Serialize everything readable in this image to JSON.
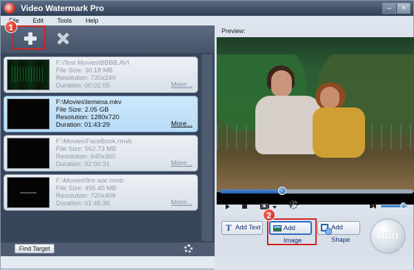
{
  "window": {
    "title": "Video Watermark Pro",
    "controls": {
      "minimize": "–",
      "close": "×"
    }
  },
  "menu": [
    "File",
    "Edit",
    "Tools",
    "Help"
  ],
  "left_panel": {
    "markers": {
      "first": "1"
    },
    "files": [
      {
        "path": "F:\\Test Movies\\BBBB.AVI",
        "size": "File Size: 30.18 MB",
        "resolution": "Resolution: 720x240",
        "duration": "Duration: 00:02:05",
        "more": "More..."
      },
      {
        "path": "F:\\Movies\\lemena.mkv",
        "size": "File Size: 2.05 GB",
        "resolution": "Resolution: 1280x720",
        "duration": "Duration: 01:43:29",
        "more": "More..."
      },
      {
        "path": "F:\\Movies\\FaceBook.rmvb",
        "size": "File Size: 562.73 MB",
        "resolution": "Resolution: 640x360",
        "duration": "Duration: 02:00:31",
        "more": "More..."
      },
      {
        "path": "F:\\Movies\\fire war.rmvb",
        "size": "File Size: 495.40 MB",
        "resolution": "Resolution: 720x408",
        "duration": "Duration: 01:45:36",
        "more": "More..."
      }
    ],
    "find_target": "Find Target"
  },
  "preview": {
    "label": "Preview:",
    "seek_position": 0.32,
    "volume_level": 0.85
  },
  "actions": {
    "add_text": "Add Text",
    "add_image": "Add Image",
    "add_shape": "Add Shape",
    "run": "Run",
    "second_marker": "2"
  },
  "colors": {
    "accent_blue": "#2a67c1",
    "highlight_red": "#d21f1f"
  }
}
